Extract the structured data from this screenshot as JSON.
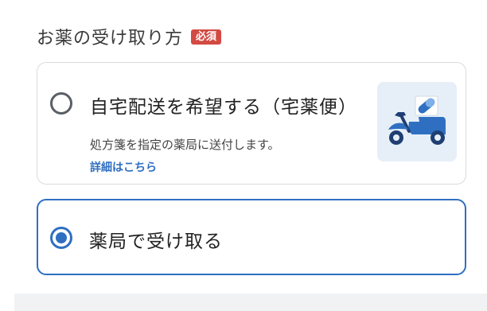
{
  "section": {
    "title": "お薬の受け取り方",
    "required_badge": "必須"
  },
  "options": [
    {
      "title": "自宅配送を希望する（宅薬便）",
      "description": "処方箋を指定の薬局に送付します。",
      "detail_link": "詳細はこちら",
      "selected": false,
      "illustration": "scooter-delivery-icon"
    },
    {
      "title": "薬局で受け取る",
      "selected": true
    }
  ],
  "colors": {
    "accent": "#2f6fc1",
    "badge": "#d24a43",
    "illustration_bg": "#e6eef8"
  }
}
